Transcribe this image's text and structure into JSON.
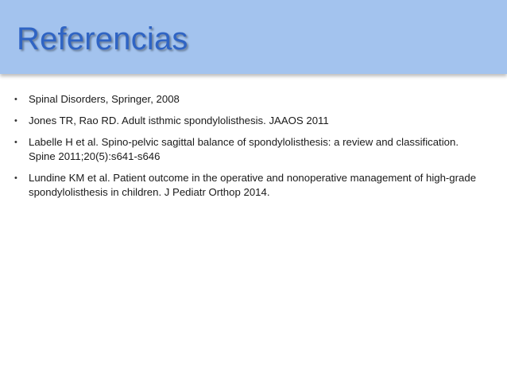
{
  "slide": {
    "title": "Referencias",
    "bullet_glyph": "•",
    "references": [
      "Spinal Disorders, Springer, 2008",
      "Jones TR, Rao RD. Adult isthmic spondylolisthesis. JAAOS 2011",
      "Labelle H et al. Spino-pelvic sagittal balance of spondylolisthesis: a review and classification. Spine 2011;20(5):s641-s646",
      "Lundine KM et al. Patient outcome in the operative and nonoperative management of high-grade spondylolisthesis in children. J Pediatr Orthop 2014."
    ]
  },
  "colors": {
    "title_bar": "#a3c3ee",
    "title_text": "#2f64c4",
    "body_text": "#1a1a1a"
  }
}
